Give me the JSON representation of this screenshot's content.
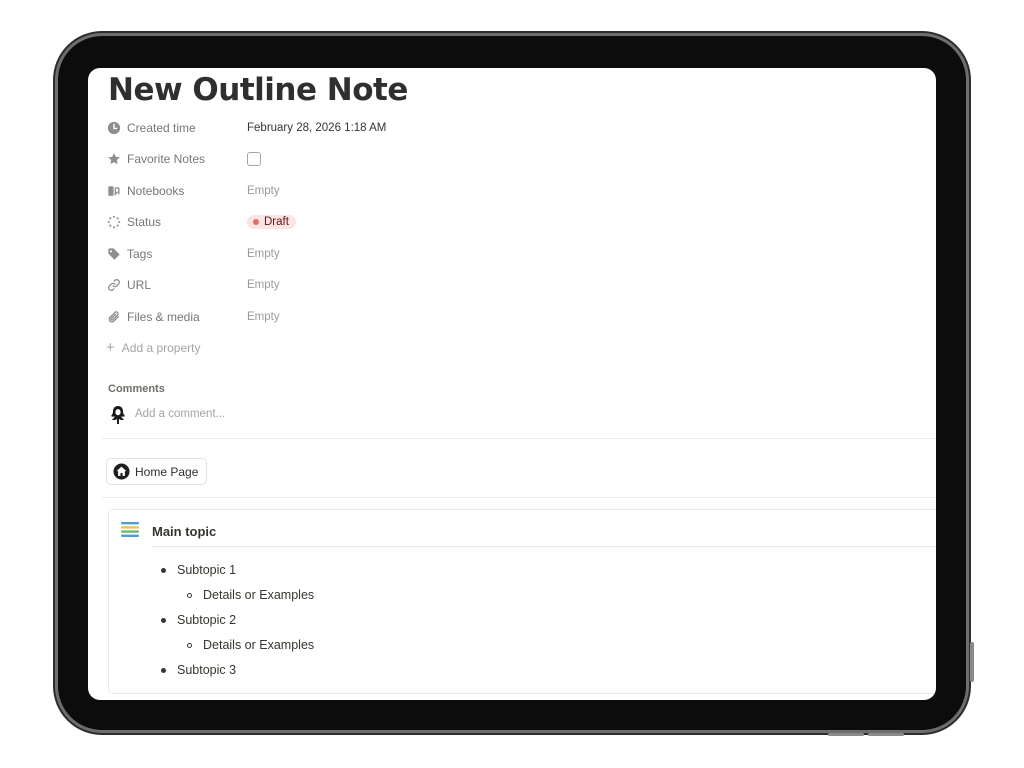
{
  "page": {
    "title": "New Outline Note"
  },
  "properties": [
    {
      "label": "Created time",
      "value": "February 28, 2026 1:18 AM",
      "icon": "clock-icon"
    },
    {
      "label": "Favorite Notes",
      "value": "",
      "icon": "star-icon",
      "checked": false
    },
    {
      "label": "Notebooks",
      "value": "Empty",
      "icon": "relation-icon"
    },
    {
      "label": "Status",
      "value": "Draft",
      "icon": "status-icon",
      "status_color": "#e16f64"
    },
    {
      "label": "Tags",
      "value": "Empty",
      "icon": "tag-icon"
    },
    {
      "label": "URL",
      "value": "Empty",
      "icon": "link-icon"
    },
    {
      "label": "Files & media",
      "value": "Empty",
      "icon": "paperclip-icon"
    }
  ],
  "add_property_label": "Add a property",
  "comments": {
    "label": "Comments",
    "placeholder": "Add a comment..."
  },
  "breadcrumb": {
    "home_label": "Home Page"
  },
  "outline": {
    "heading": "Main topic",
    "items": [
      {
        "level": 1,
        "text": "Subtopic 1"
      },
      {
        "level": 2,
        "text": "Details or Examples"
      },
      {
        "level": 1,
        "text": "Subtopic 2"
      },
      {
        "level": 2,
        "text": "Details or Examples"
      },
      {
        "level": 1,
        "text": "Subtopic 3"
      }
    ]
  },
  "colors": {
    "status_bg": "#fbe4e4",
    "status_dot": "#e16f64",
    "text_primary": "#37352f",
    "text_muted": "#787774"
  }
}
